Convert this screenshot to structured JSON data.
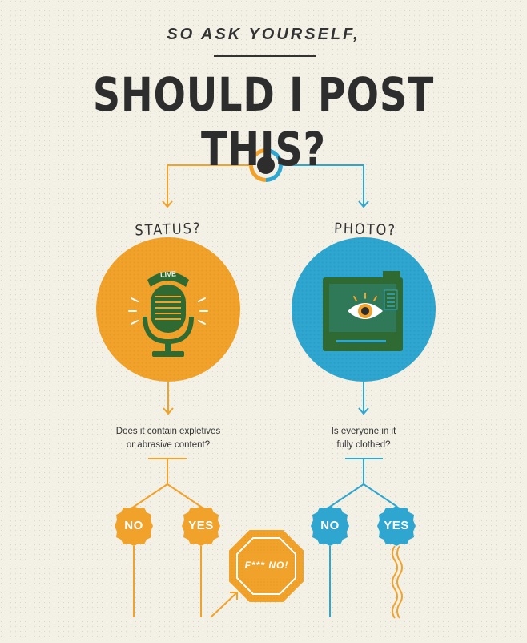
{
  "header": {
    "subtitle": "SO ASK YOURSELF,",
    "title": "SHOULD I POST THIS?"
  },
  "branches": {
    "status": {
      "label": "STATUS?",
      "question_line1": "Does it contain expletives",
      "question_line2": "or abrasive content?",
      "badge_live": "LIVE",
      "no_label": "NO",
      "yes_label": "YES",
      "stop_label": "F*** NO!"
    },
    "photo": {
      "label": "PHOTO?",
      "question_line1": "Is everyone in it",
      "question_line2": "fully clothed?",
      "no_label": "NO",
      "yes_label": "YES"
    }
  },
  "colors": {
    "orange": "#f0a22a",
    "blue": "#2ea6cf",
    "green": "#2f6a32",
    "dark": "#2d2d2d",
    "background": "#f3f0e6"
  },
  "icons": {
    "start": "start-node-icon",
    "status": "microphone-icon",
    "photo": "camera-icon",
    "stop": "stop-sign-icon"
  }
}
